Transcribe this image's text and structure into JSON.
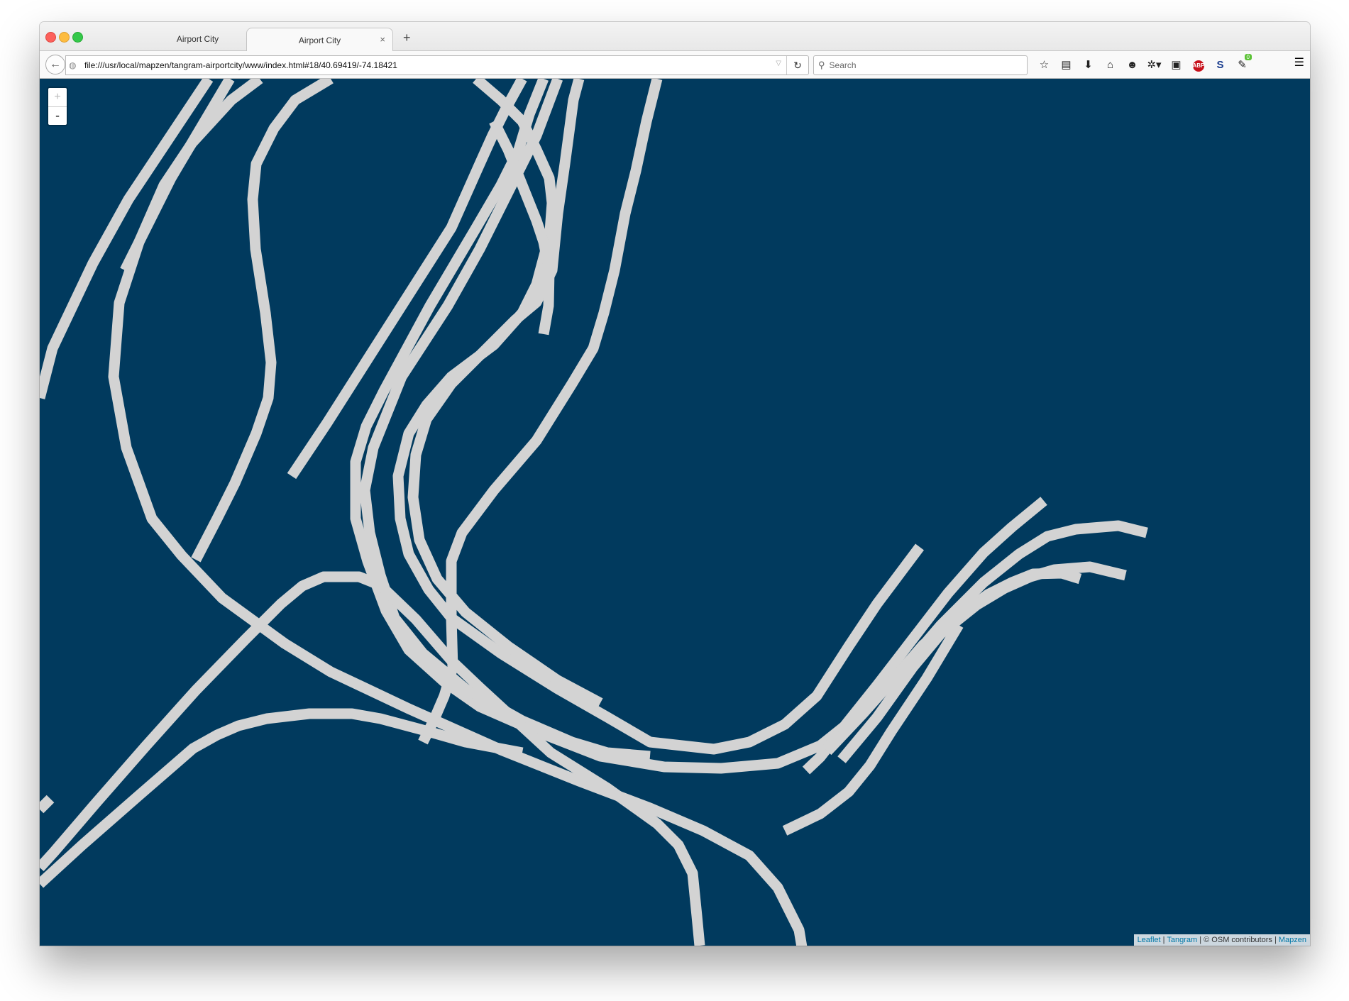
{
  "window": {
    "tabs": [
      {
        "label": "Airport City"
      },
      {
        "label": "Airport City"
      }
    ],
    "tab_close_glyph": "×",
    "new_tab_glyph": "+"
  },
  "navbar": {
    "back_icon": "←",
    "url": "file:///usr/local/mapzen/tangram-airportcity/www/index.html#18/40.69419/-74.18421",
    "search_placeholder": "Search",
    "badge_count": "0"
  },
  "map": {
    "zoom_in": "+",
    "zoom_out": "-",
    "attribution": {
      "leaflet": "Leaflet",
      "sep1": " | ",
      "tangram": "Tangram",
      "osm": " | © OSM contributors | ",
      "mapzen": "Mapzen"
    },
    "background": "#013a5e",
    "road_color": "#d3d3d3"
  }
}
